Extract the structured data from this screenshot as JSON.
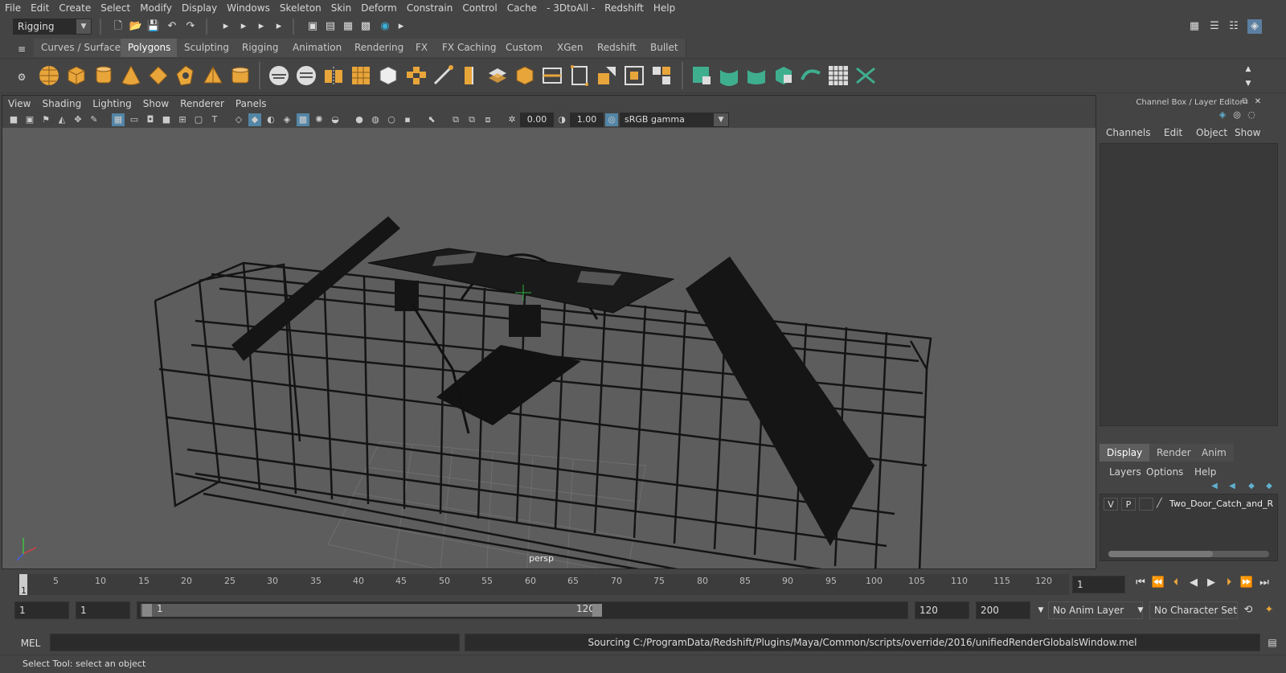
{
  "menubar": [
    "File",
    "Edit",
    "Create",
    "Select",
    "Modify",
    "Display",
    "Windows",
    "Skeleton",
    "Skin",
    "Deform",
    "Constrain",
    "Control",
    "Cache",
    "- 3DtoAll -",
    "Redshift",
    "Help"
  ],
  "menuset": "Rigging",
  "shelf_tabs": [
    "Curves / Surfaces",
    "Polygons",
    "Sculpting",
    "Rigging",
    "Animation",
    "Rendering",
    "FX",
    "FX Caching",
    "Custom",
    "XGen",
    "Redshift",
    "Bullet"
  ],
  "active_shelf_tab": "Polygons",
  "panel_menu": [
    "View",
    "Shading",
    "Lighting",
    "Show",
    "Renderer",
    "Panels"
  ],
  "viewport": {
    "exposure": "0.00",
    "gamma": "1.00",
    "color_space": "sRGB gamma",
    "camera_label": "persp"
  },
  "right_panel": {
    "title": "Channel Box / Layer Editor",
    "menus": [
      "Channels",
      "Edit",
      "Object",
      "Show"
    ],
    "tabs": [
      "Display",
      "Render",
      "Anim"
    ],
    "active_tab": "Display",
    "layer_menus": [
      "Layers",
      "Options",
      "Help"
    ],
    "layer": {
      "v": "V",
      "p": "P",
      "name": "Two_Door_Catch_and_R"
    }
  },
  "timeline": {
    "ticks": [
      "5",
      "10",
      "15",
      "20",
      "25",
      "30",
      "35",
      "40",
      "45",
      "50",
      "55",
      "60",
      "65",
      "70",
      "75",
      "80",
      "85",
      "90",
      "95",
      "100",
      "105",
      "110",
      "115",
      "120"
    ],
    "start_label": "1",
    "current_frame": "1"
  },
  "range": {
    "start_field": "1",
    "playback_start": "1",
    "slider_start": "1",
    "slider_end": "120",
    "playback_end": "120",
    "end_field": "200",
    "anim_layer": "No Anim Layer",
    "character_set": "No Character Set"
  },
  "cmdline": {
    "language": "MEL",
    "result": "Sourcing C:/ProgramData/Redshift/Plugins/Maya/Common/scripts/override/2016/unifiedRenderGlobalsWindow.mel"
  },
  "helpline": "Select Tool: select an object",
  "colors": {
    "accent": "#5285a6",
    "shelf_orange": "#e8a53a",
    "shelf_green": "#3fae8f"
  }
}
